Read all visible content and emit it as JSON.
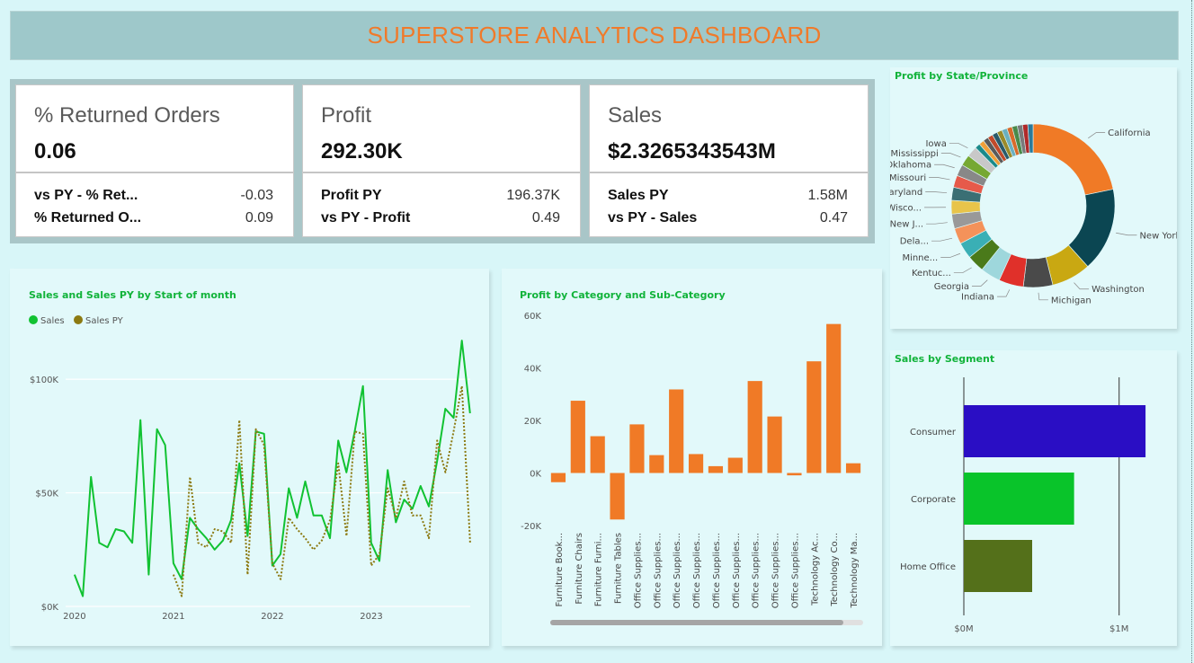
{
  "title": "SUPERSTORE ANALYTICS DASHBOARD",
  "kpis": [
    {
      "title": "% Returned Orders",
      "value": "0.06",
      "rows": [
        {
          "label": "vs PY - % Ret...",
          "value": "-0.03"
        },
        {
          "label": "% Returned O...",
          "value": "0.09"
        }
      ]
    },
    {
      "title": "Profit",
      "value": "292.30K",
      "rows": [
        {
          "label": "Profit PY",
          "value": "196.37K"
        },
        {
          "label": "vs PY - Profit",
          "value": "0.49"
        }
      ]
    },
    {
      "title": "Sales",
      "value": "$2.3265343543M",
      "rows": [
        {
          "label": "Sales PY",
          "value": "1.58M"
        },
        {
          "label": "vs PY - Sales",
          "value": "0.47"
        }
      ]
    }
  ],
  "colors": {
    "sales": "#11c232",
    "sales_py": "#8c7a12",
    "bar": "#f07a26",
    "title": "#f07a2a",
    "panel_title": "#11b33a"
  },
  "chart_data": [
    {
      "id": "line",
      "type": "line",
      "title": "Sales and Sales PY by Start of month",
      "legend": [
        "Sales",
        "Sales PY"
      ],
      "legend_position": "top-left",
      "y_ticks": [
        {
          "v": 0,
          "label": "$0K"
        },
        {
          "v": 50000,
          "label": "$50K"
        },
        {
          "v": 100000,
          "label": "$100K"
        }
      ],
      "x_ticks": [
        {
          "v": 2020,
          "label": "2020"
        },
        {
          "v": 2021,
          "label": "2021"
        },
        {
          "v": 2022,
          "label": "2022"
        },
        {
          "v": 2023,
          "label": "2023"
        }
      ],
      "xlim": [
        2019.91,
        2024.0
      ],
      "ylim": [
        0,
        121000
      ],
      "series": [
        {
          "name": "Sales",
          "x_start": 2020.0,
          "step": 0.0833,
          "values": [
            14000,
            4500,
            57000,
            28000,
            26000,
            34000,
            33000,
            28000,
            82000,
            14000,
            78000,
            71000,
            19000,
            12000,
            39000,
            34000,
            30000,
            25000,
            29000,
            38000,
            63000,
            31000,
            77000,
            76000,
            18000,
            23000,
            52000,
            39000,
            55000,
            40000,
            40000,
            30000,
            73000,
            59000,
            77000,
            97000,
            28000,
            20000,
            60000,
            37000,
            47000,
            43000,
            53000,
            44000,
            64000,
            87000,
            83000,
            117000,
            85000
          ]
        },
        {
          "name": "Sales PY",
          "x_start": 2021.0,
          "step": 0.0833,
          "values": [
            14000,
            4500,
            57000,
            28000,
            26000,
            34000,
            33000,
            28000,
            82000,
            14000,
            78000,
            71000,
            19000,
            12000,
            39000,
            34000,
            30000,
            25000,
            29000,
            38000,
            63000,
            31000,
            77000,
            76000,
            18000,
            23000,
            52000,
            39000,
            55000,
            40000,
            40000,
            30000,
            73000,
            59000,
            77000,
            97000,
            28000
          ]
        }
      ]
    },
    {
      "id": "bar",
      "type": "bar",
      "title": "Profit by Category and Sub-Category",
      "y_ticks": [
        {
          "v": -20000,
          "label": "-20K"
        },
        {
          "v": 0,
          "label": "0K"
        },
        {
          "v": 20000,
          "label": "20K"
        },
        {
          "v": 40000,
          "label": "40K"
        },
        {
          "v": 60000,
          "label": "60K"
        }
      ],
      "ylim": [
        -20000,
        60000
      ],
      "categories": [
        "Furniture Book...",
        "Furniture Chairs",
        "Furniture Furni...",
        "Furniture Tables",
        "Office Supplies...",
        "Office Supplies...",
        "Office Supplies...",
        "Office Supplies...",
        "Office Supplies...",
        "Office Supplies...",
        "Office Supplies...",
        "Office Supplies...",
        "Office Supplies...",
        "Technology Ac...",
        "Technology Co...",
        "Technology Ma..."
      ],
      "values": [
        -3500,
        27500,
        14000,
        -17700,
        18500,
        6800,
        31800,
        7200,
        2600,
        5800,
        35000,
        21500,
        -900,
        42500,
        56700,
        3700
      ]
    },
    {
      "id": "donut",
      "type": "pie",
      "title": "Profit by State/Province",
      "labels": [
        "California",
        "New York",
        "Washington",
        "Michigan",
        "Indiana",
        "Georgia",
        "Kentuc...",
        "Minne...",
        "Dela...",
        "New J...",
        "Wisco...",
        "Maryland",
        "Missouri",
        "Oklahoma",
        "Mississippi",
        "Iowa"
      ],
      "values": [
        21,
        16,
        7.5,
        5.6,
        4.7,
        3.8,
        3.3,
        3.1,
        3.0,
        2.8,
        2.6,
        2.5,
        2.3,
        2.2,
        2.1,
        2.0
      ],
      "other_slices": 12,
      "colors": [
        "#f07a26",
        "#0b4652",
        "#c9a812",
        "#4a4a4a",
        "#e0302a",
        "#9ed7dc",
        "#4a7a1a",
        "#3aafb5",
        "#f4925a",
        "#999999",
        "#e8c44a",
        "#3a6f74",
        "#e65a4a",
        "#888888",
        "#76a832",
        "#c8c8c8"
      ],
      "small_colors": [
        "#1b8a8a",
        "#f0a03a",
        "#5a5a5a",
        "#c24a2a",
        "#2a5a6a",
        "#9a8a2a",
        "#6ab0c0",
        "#d86a2a",
        "#4a8a4a",
        "#7a7a7a",
        "#b02a2a",
        "#2a7a9a"
      ]
    },
    {
      "id": "hbar",
      "type": "bar",
      "orientation": "horizontal",
      "title": "Sales by Segment",
      "categories": [
        "Consumer",
        "Corporate",
        "Home Office"
      ],
      "values": [
        1170000,
        710000,
        440000
      ],
      "colors": [
        "#2a0ec4",
        "#09c42a",
        "#54701a"
      ],
      "x_ticks": [
        {
          "v": 0,
          "label": "$0M"
        },
        {
          "v": 1000000,
          "label": "$1M"
        }
      ],
      "xlim": [
        0,
        1320000
      ]
    }
  ]
}
